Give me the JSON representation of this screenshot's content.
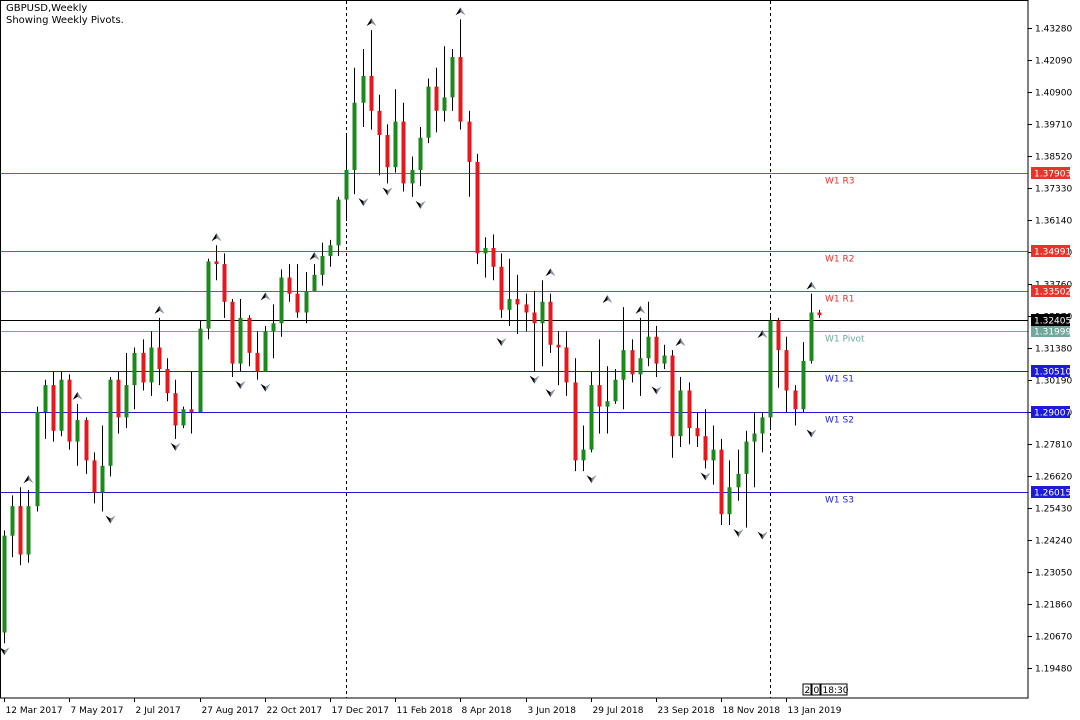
{
  "header": {
    "symbol": "GBPUSD,Weekly",
    "subtitle": "Showing Weekly Pivots."
  },
  "chart_data": {
    "type": "candlestick",
    "title": "GBPUSD,Weekly",
    "subtitle": "Showing Weekly Pivots.",
    "timeframe": "Weekly",
    "ylim": [
      1.1894,
      1.4383
    ],
    "y_ticks": [
      "1.43280",
      "1.42090",
      "1.40900",
      "1.39710",
      "1.38520",
      "1.37330",
      "1.36140",
      "1.34950",
      "1.33760",
      "1.32570",
      "1.31380",
      "1.30190",
      "1.29000",
      "1.27810",
      "1.26620",
      "1.25430",
      "1.24240",
      "1.23050",
      "1.21860",
      "1.20670",
      "1.19480"
    ],
    "x_ticks": [
      {
        "label": "12 Mar 2017",
        "i": 0
      },
      {
        "label": "7 May 2017",
        "i": 8
      },
      {
        "label": "2 Jul 2017",
        "i": 16
      },
      {
        "label": "27 Aug 2017",
        "i": 24
      },
      {
        "label": "22 Oct 2017",
        "i": 32
      },
      {
        "label": "17 Dec 2017",
        "i": 40
      },
      {
        "label": "11 Feb 2018",
        "i": 48
      },
      {
        "label": "8 Apr 2018",
        "i": 56
      },
      {
        "label": "3 Jun 2018",
        "i": 64
      },
      {
        "label": "29 Jul 2018",
        "i": 72
      },
      {
        "label": "23 Sep 2018",
        "i": 80
      },
      {
        "label": "18 Nov 2018",
        "i": 88
      },
      {
        "label": "13 Jan 2019",
        "i": 96
      }
    ],
    "period_separators": [
      42,
      94
    ],
    "pivots": [
      {
        "name": "W1 R3",
        "value": 1.37903,
        "label": "1.37903",
        "color": "#e8332b",
        "tag_text": "#ffffff"
      },
      {
        "name": "W1 R2",
        "value": 1.34991,
        "label": "1.34991",
        "color": "#e8332b",
        "tag_text": "#ffffff"
      },
      {
        "name": "W1 R1",
        "value": 1.33502,
        "label": "1.33502",
        "color": "#e8332b",
        "tag_text": "#ffffff"
      },
      {
        "name": "W1 Pivot",
        "value": 1.31999,
        "label": "1.31999",
        "color": "#6fa89c",
        "tag_text": "#ffffff"
      },
      {
        "name": "W1 S1",
        "value": 1.3051,
        "label": "1.30510",
        "color": "#1c1cd8",
        "tag_text": "#ffffff"
      },
      {
        "name": "W1 S2",
        "value": 1.29007,
        "label": "1.29007",
        "color": "#1c1cd8",
        "tag_text": "#ffffff"
      },
      {
        "name": "W1 S3",
        "value": 1.26015,
        "label": "1.26015",
        "color": "#1c1cd8",
        "tag_text": "#ffffff"
      }
    ],
    "current_price": {
      "value": 1.32405,
      "label": "1.32405",
      "color": "#000000"
    },
    "countdown": [
      "2",
      "0",
      "18:30"
    ],
    "colors": {
      "bull": "#1a8a1a",
      "bear": "#e8171c",
      "wick": "#000000",
      "grid": "#000000"
    },
    "candles": [
      [
        1.208,
        1.244,
        1.204,
        1.246
      ],
      [
        1.244,
        1.255,
        1.236,
        1.259
      ],
      [
        1.255,
        1.237,
        1.233,
        1.262
      ],
      [
        1.237,
        1.255,
        1.234,
        1.261
      ],
      [
        1.255,
        1.29,
        1.253,
        1.292
      ],
      [
        1.29,
        1.3,
        1.28,
        1.302
      ],
      [
        1.3,
        1.283,
        1.279,
        1.305
      ],
      [
        1.283,
        1.302,
        1.281,
        1.305
      ],
      [
        1.302,
        1.279,
        1.276,
        1.304
      ],
      [
        1.279,
        1.287,
        1.27,
        1.293
      ],
      [
        1.287,
        1.272,
        1.267,
        1.288
      ],
      [
        1.272,
        1.26,
        1.256,
        1.275
      ],
      [
        1.26,
        1.27,
        1.253,
        1.285
      ],
      [
        1.27,
        1.302,
        1.266,
        1.303
      ],
      [
        1.302,
        1.288,
        1.282,
        1.305
      ],
      [
        1.288,
        1.3,
        1.284,
        1.312
      ],
      [
        1.3,
        1.312,
        1.291,
        1.314
      ],
      [
        1.312,
        1.301,
        1.298,
        1.317
      ],
      [
        1.301,
        1.314,
        1.296,
        1.32
      ],
      [
        1.314,
        1.306,
        1.3,
        1.325
      ],
      [
        1.306,
        1.297,
        1.294,
        1.31
      ],
      [
        1.297,
        1.285,
        1.28,
        1.302
      ],
      [
        1.285,
        1.291,
        1.284,
        1.292
      ],
      [
        1.291,
        1.29,
        1.282,
        1.305
      ],
      [
        1.29,
        1.321,
        1.29,
        1.324
      ],
      [
        1.321,
        1.346,
        1.317,
        1.347
      ],
      [
        1.346,
        1.345,
        1.339,
        1.352
      ],
      [
        1.345,
        1.331,
        1.325,
        1.349
      ],
      [
        1.331,
        1.308,
        1.303,
        1.332
      ],
      [
        1.308,
        1.325,
        1.305,
        1.332
      ],
      [
        1.325,
        1.312,
        1.307,
        1.326
      ],
      [
        1.312,
        1.305,
        1.302,
        1.32
      ],
      [
        1.305,
        1.32,
        1.305,
        1.322
      ],
      [
        1.32,
        1.323,
        1.31,
        1.33
      ],
      [
        1.323,
        1.34,
        1.318,
        1.343
      ],
      [
        1.34,
        1.334,
        1.331,
        1.345
      ],
      [
        1.334,
        1.327,
        1.325,
        1.345
      ],
      [
        1.327,
        1.335,
        1.323,
        1.342
      ],
      [
        1.335,
        1.341,
        1.335,
        1.345
      ],
      [
        1.341,
        1.348,
        1.337,
        1.353
      ],
      [
        1.348,
        1.352,
        1.344,
        1.354
      ],
      [
        1.352,
        1.369,
        1.348,
        1.37
      ],
      [
        1.369,
        1.38,
        1.361,
        1.393
      ],
      [
        1.38,
        1.405,
        1.371,
        1.418
      ],
      [
        1.405,
        1.415,
        1.396,
        1.425
      ],
      [
        1.415,
        1.402,
        1.395,
        1.432
      ],
      [
        1.402,
        1.393,
        1.378,
        1.408
      ],
      [
        1.393,
        1.381,
        1.375,
        1.397
      ],
      [
        1.381,
        1.398,
        1.379,
        1.41
      ],
      [
        1.398,
        1.375,
        1.372,
        1.405
      ],
      [
        1.375,
        1.38,
        1.37,
        1.385
      ],
      [
        1.38,
        1.392,
        1.374,
        1.396
      ],
      [
        1.392,
        1.411,
        1.39,
        1.414
      ],
      [
        1.411,
        1.402,
        1.394,
        1.418
      ],
      [
        1.402,
        1.407,
        1.398,
        1.426
      ],
      [
        1.407,
        1.422,
        1.402,
        1.425
      ],
      [
        1.422,
        1.398,
        1.395,
        1.436
      ],
      [
        1.398,
        1.383,
        1.37,
        1.402
      ],
      [
        1.383,
        1.349,
        1.345,
        1.386
      ],
      [
        1.349,
        1.351,
        1.34,
        1.355
      ],
      [
        1.351,
        1.344,
        1.339,
        1.356
      ],
      [
        1.344,
        1.328,
        1.325,
        1.349
      ],
      [
        1.328,
        1.332,
        1.322,
        1.347
      ],
      [
        1.332,
        1.33,
        1.319,
        1.341
      ],
      [
        1.33,
        1.327,
        1.32,
        1.334
      ],
      [
        1.327,
        1.323,
        1.305,
        1.335
      ],
      [
        1.323,
        1.331,
        1.307,
        1.339
      ],
      [
        1.331,
        1.315,
        1.312,
        1.334
      ],
      [
        1.315,
        1.314,
        1.3,
        1.32
      ],
      [
        1.314,
        1.301,
        1.296,
        1.32
      ],
      [
        1.301,
        1.272,
        1.268,
        1.31
      ],
      [
        1.272,
        1.276,
        1.268,
        1.285
      ],
      [
        1.276,
        1.3,
        1.275,
        1.305
      ],
      [
        1.3,
        1.292,
        1.282,
        1.317
      ],
      [
        1.292,
        1.294,
        1.282,
        1.307
      ],
      [
        1.294,
        1.302,
        1.293,
        1.306
      ],
      [
        1.302,
        1.313,
        1.291,
        1.329
      ],
      [
        1.313,
        1.304,
        1.301,
        1.317
      ],
      [
        1.304,
        1.31,
        1.296,
        1.325
      ],
      [
        1.31,
        1.318,
        1.307,
        1.331
      ],
      [
        1.318,
        1.308,
        1.303,
        1.322
      ],
      [
        1.308,
        1.311,
        1.306,
        1.315
      ],
      [
        1.311,
        1.281,
        1.273,
        1.313
      ],
      [
        1.281,
        1.298,
        1.277,
        1.303
      ],
      [
        1.298,
        1.284,
        1.278,
        1.301
      ],
      [
        1.284,
        1.281,
        1.277,
        1.29
      ],
      [
        1.281,
        1.272,
        1.269,
        1.291
      ],
      [
        1.272,
        1.276,
        1.263,
        1.285
      ],
      [
        1.276,
        1.252,
        1.248,
        1.28
      ],
      [
        1.252,
        1.262,
        1.248,
        1.272
      ],
      [
        1.262,
        1.267,
        1.257,
        1.276
      ],
      [
        1.267,
        1.279,
        1.247,
        1.283
      ],
      [
        1.279,
        1.282,
        1.262,
        1.29
      ],
      [
        1.282,
        1.288,
        1.275,
        1.29
      ],
      [
        1.288,
        1.324,
        1.284,
        1.326
      ],
      [
        1.324,
        1.313,
        1.299,
        1.325
      ],
      [
        1.313,
        1.298,
        1.29,
        1.318
      ],
      [
        1.298,
        1.291,
        1.285,
        1.3
      ],
      [
        1.291,
        1.309,
        1.29,
        1.316
      ],
      [
        1.309,
        1.327,
        1.308,
        1.334
      ],
      [
        1.327,
        1.326,
        1.325,
        1.328
      ]
    ],
    "fractals": {
      "up": [
        [
          3,
          1.262
        ],
        [
          9,
          1.293
        ],
        [
          19,
          1.325
        ],
        [
          26,
          1.352
        ],
        [
          32,
          1.33
        ],
        [
          38,
          1.345
        ],
        [
          45,
          1.432
        ],
        [
          56,
          1.436
        ],
        [
          67,
          1.339
        ],
        [
          74,
          1.329
        ],
        [
          78,
          1.325
        ],
        [
          83,
          1.313
        ],
        [
          93,
          1.316
        ],
        [
          99,
          1.334
        ]
      ],
      "down": [
        [
          0,
          1.204
        ],
        [
          13,
          1.253
        ],
        [
          21,
          1.28
        ],
        [
          29,
          1.303
        ],
        [
          32,
          1.302
        ],
        [
          44,
          1.371
        ],
        [
          47,
          1.375
        ],
        [
          51,
          1.37
        ],
        [
          61,
          1.319
        ],
        [
          65,
          1.305
        ],
        [
          67,
          1.3
        ],
        [
          72,
          1.268
        ],
        [
          80,
          1.301
        ],
        [
          86,
          1.269
        ],
        [
          90,
          1.248
        ],
        [
          93,
          1.247
        ],
        [
          99,
          1.285
        ]
      ]
    }
  }
}
